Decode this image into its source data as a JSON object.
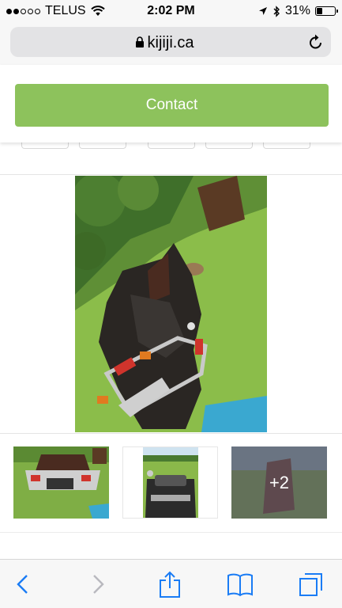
{
  "status": {
    "carrier": "TELUS",
    "time": "2:02 PM",
    "battery": "31%"
  },
  "browser": {
    "url": "kijiji.ca"
  },
  "listing": {
    "contact_label": "Contact",
    "more_photos": "+2"
  }
}
